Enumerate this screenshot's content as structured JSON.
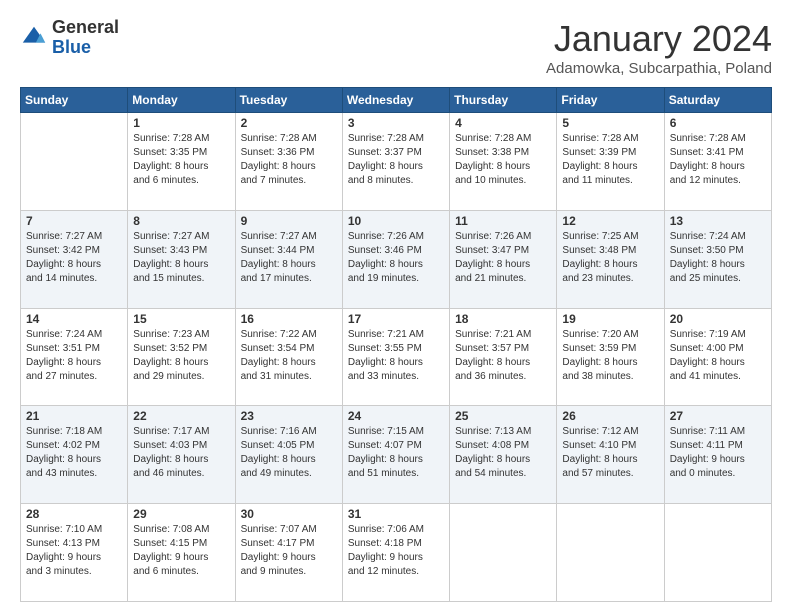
{
  "header": {
    "logo": {
      "general": "General",
      "blue": "Blue"
    },
    "title": "January 2024",
    "location": "Adamowka, Subcarpathia, Poland"
  },
  "weekdays": [
    "Sunday",
    "Monday",
    "Tuesday",
    "Wednesday",
    "Thursday",
    "Friday",
    "Saturday"
  ],
  "weeks": [
    [
      {
        "day": "",
        "info": ""
      },
      {
        "day": "1",
        "info": "Sunrise: 7:28 AM\nSunset: 3:35 PM\nDaylight: 8 hours\nand 6 minutes."
      },
      {
        "day": "2",
        "info": "Sunrise: 7:28 AM\nSunset: 3:36 PM\nDaylight: 8 hours\nand 7 minutes."
      },
      {
        "day": "3",
        "info": "Sunrise: 7:28 AM\nSunset: 3:37 PM\nDaylight: 8 hours\nand 8 minutes."
      },
      {
        "day": "4",
        "info": "Sunrise: 7:28 AM\nSunset: 3:38 PM\nDaylight: 8 hours\nand 10 minutes."
      },
      {
        "day": "5",
        "info": "Sunrise: 7:28 AM\nSunset: 3:39 PM\nDaylight: 8 hours\nand 11 minutes."
      },
      {
        "day": "6",
        "info": "Sunrise: 7:28 AM\nSunset: 3:41 PM\nDaylight: 8 hours\nand 12 minutes."
      }
    ],
    [
      {
        "day": "7",
        "info": "Sunrise: 7:27 AM\nSunset: 3:42 PM\nDaylight: 8 hours\nand 14 minutes."
      },
      {
        "day": "8",
        "info": "Sunrise: 7:27 AM\nSunset: 3:43 PM\nDaylight: 8 hours\nand 15 minutes."
      },
      {
        "day": "9",
        "info": "Sunrise: 7:27 AM\nSunset: 3:44 PM\nDaylight: 8 hours\nand 17 minutes."
      },
      {
        "day": "10",
        "info": "Sunrise: 7:26 AM\nSunset: 3:46 PM\nDaylight: 8 hours\nand 19 minutes."
      },
      {
        "day": "11",
        "info": "Sunrise: 7:26 AM\nSunset: 3:47 PM\nDaylight: 8 hours\nand 21 minutes."
      },
      {
        "day": "12",
        "info": "Sunrise: 7:25 AM\nSunset: 3:48 PM\nDaylight: 8 hours\nand 23 minutes."
      },
      {
        "day": "13",
        "info": "Sunrise: 7:24 AM\nSunset: 3:50 PM\nDaylight: 8 hours\nand 25 minutes."
      }
    ],
    [
      {
        "day": "14",
        "info": "Sunrise: 7:24 AM\nSunset: 3:51 PM\nDaylight: 8 hours\nand 27 minutes."
      },
      {
        "day": "15",
        "info": "Sunrise: 7:23 AM\nSunset: 3:52 PM\nDaylight: 8 hours\nand 29 minutes."
      },
      {
        "day": "16",
        "info": "Sunrise: 7:22 AM\nSunset: 3:54 PM\nDaylight: 8 hours\nand 31 minutes."
      },
      {
        "day": "17",
        "info": "Sunrise: 7:21 AM\nSunset: 3:55 PM\nDaylight: 8 hours\nand 33 minutes."
      },
      {
        "day": "18",
        "info": "Sunrise: 7:21 AM\nSunset: 3:57 PM\nDaylight: 8 hours\nand 36 minutes."
      },
      {
        "day": "19",
        "info": "Sunrise: 7:20 AM\nSunset: 3:59 PM\nDaylight: 8 hours\nand 38 minutes."
      },
      {
        "day": "20",
        "info": "Sunrise: 7:19 AM\nSunset: 4:00 PM\nDaylight: 8 hours\nand 41 minutes."
      }
    ],
    [
      {
        "day": "21",
        "info": "Sunrise: 7:18 AM\nSunset: 4:02 PM\nDaylight: 8 hours\nand 43 minutes."
      },
      {
        "day": "22",
        "info": "Sunrise: 7:17 AM\nSunset: 4:03 PM\nDaylight: 8 hours\nand 46 minutes."
      },
      {
        "day": "23",
        "info": "Sunrise: 7:16 AM\nSunset: 4:05 PM\nDaylight: 8 hours\nand 49 minutes."
      },
      {
        "day": "24",
        "info": "Sunrise: 7:15 AM\nSunset: 4:07 PM\nDaylight: 8 hours\nand 51 minutes."
      },
      {
        "day": "25",
        "info": "Sunrise: 7:13 AM\nSunset: 4:08 PM\nDaylight: 8 hours\nand 54 minutes."
      },
      {
        "day": "26",
        "info": "Sunrise: 7:12 AM\nSunset: 4:10 PM\nDaylight: 8 hours\nand 57 minutes."
      },
      {
        "day": "27",
        "info": "Sunrise: 7:11 AM\nSunset: 4:11 PM\nDaylight: 9 hours\nand 0 minutes."
      }
    ],
    [
      {
        "day": "28",
        "info": "Sunrise: 7:10 AM\nSunset: 4:13 PM\nDaylight: 9 hours\nand 3 minutes."
      },
      {
        "day": "29",
        "info": "Sunrise: 7:08 AM\nSunset: 4:15 PM\nDaylight: 9 hours\nand 6 minutes."
      },
      {
        "day": "30",
        "info": "Sunrise: 7:07 AM\nSunset: 4:17 PM\nDaylight: 9 hours\nand 9 minutes."
      },
      {
        "day": "31",
        "info": "Sunrise: 7:06 AM\nSunset: 4:18 PM\nDaylight: 9 hours\nand 12 minutes."
      },
      {
        "day": "",
        "info": ""
      },
      {
        "day": "",
        "info": ""
      },
      {
        "day": "",
        "info": ""
      }
    ]
  ]
}
